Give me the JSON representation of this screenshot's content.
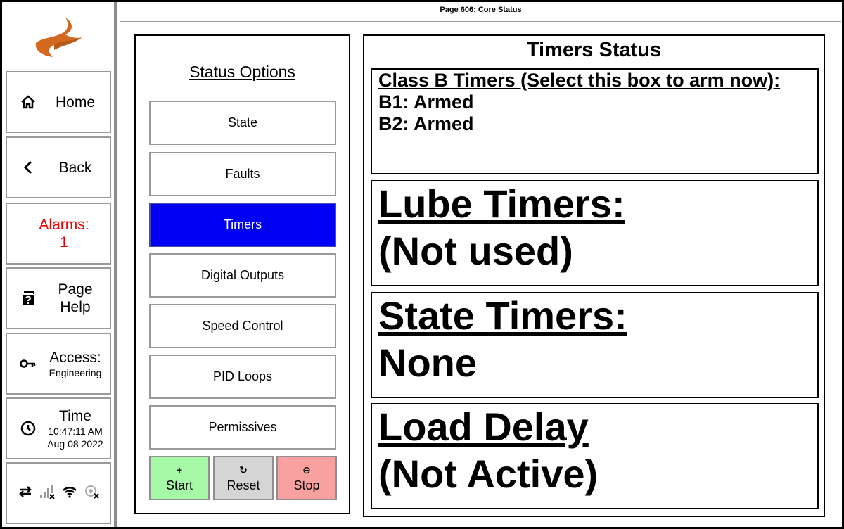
{
  "header": {
    "page_title": "Page 606: Core Status"
  },
  "sidebar": {
    "home_label": "Home",
    "back_label": "Back",
    "alarms_label": "Alarms:",
    "alarms_count": "1",
    "help_label_1": "Page",
    "help_label_2": "Help",
    "access_label": "Access:",
    "access_level": "Engineering",
    "time_label": "Time",
    "time_value": "10:47:11 AM",
    "date_value": "Aug 08 2022",
    "icons": [
      "home-icon",
      "chevron-left-icon",
      "help-book-icon",
      "key-icon",
      "clock-icon",
      "swap-arrows-icon",
      "cell-signal-off-icon",
      "wifi-icon",
      "gps-off-icon"
    ]
  },
  "options": {
    "heading": "Status Options",
    "items": [
      {
        "label": "State",
        "active": false
      },
      {
        "label": "Faults",
        "active": false
      },
      {
        "label": "Timers",
        "active": true
      },
      {
        "label": "Digital Outputs",
        "active": false
      },
      {
        "label": "Speed Control",
        "active": false
      },
      {
        "label": "PID Loops",
        "active": false
      },
      {
        "label": "Permissives",
        "active": false
      }
    ],
    "controls": {
      "start_icon": "+",
      "start_label": "Start",
      "reset_icon": "↻",
      "reset_label": "Reset",
      "stop_icon": "⊖",
      "stop_label": "Stop"
    }
  },
  "timers": {
    "heading": "Timers Status",
    "class_b": {
      "title": "Class B Timers (Select this box to arm now):",
      "b1": "B1: Armed",
      "b2": "B2: Armed"
    },
    "lube": {
      "title": "Lube Timers:",
      "value": "(Not used)"
    },
    "state": {
      "title": "State Timers:",
      "value": "None"
    },
    "load": {
      "title": "Load Delay",
      "value": "(Not Active)"
    }
  },
  "colors": {
    "active_option": "#0000f4",
    "alarm_text": "#f20000",
    "start_bg": "#a6f9a6",
    "reset_bg": "#d5d5d5",
    "stop_bg": "#f9a1a1",
    "logo": "#d2691e"
  }
}
